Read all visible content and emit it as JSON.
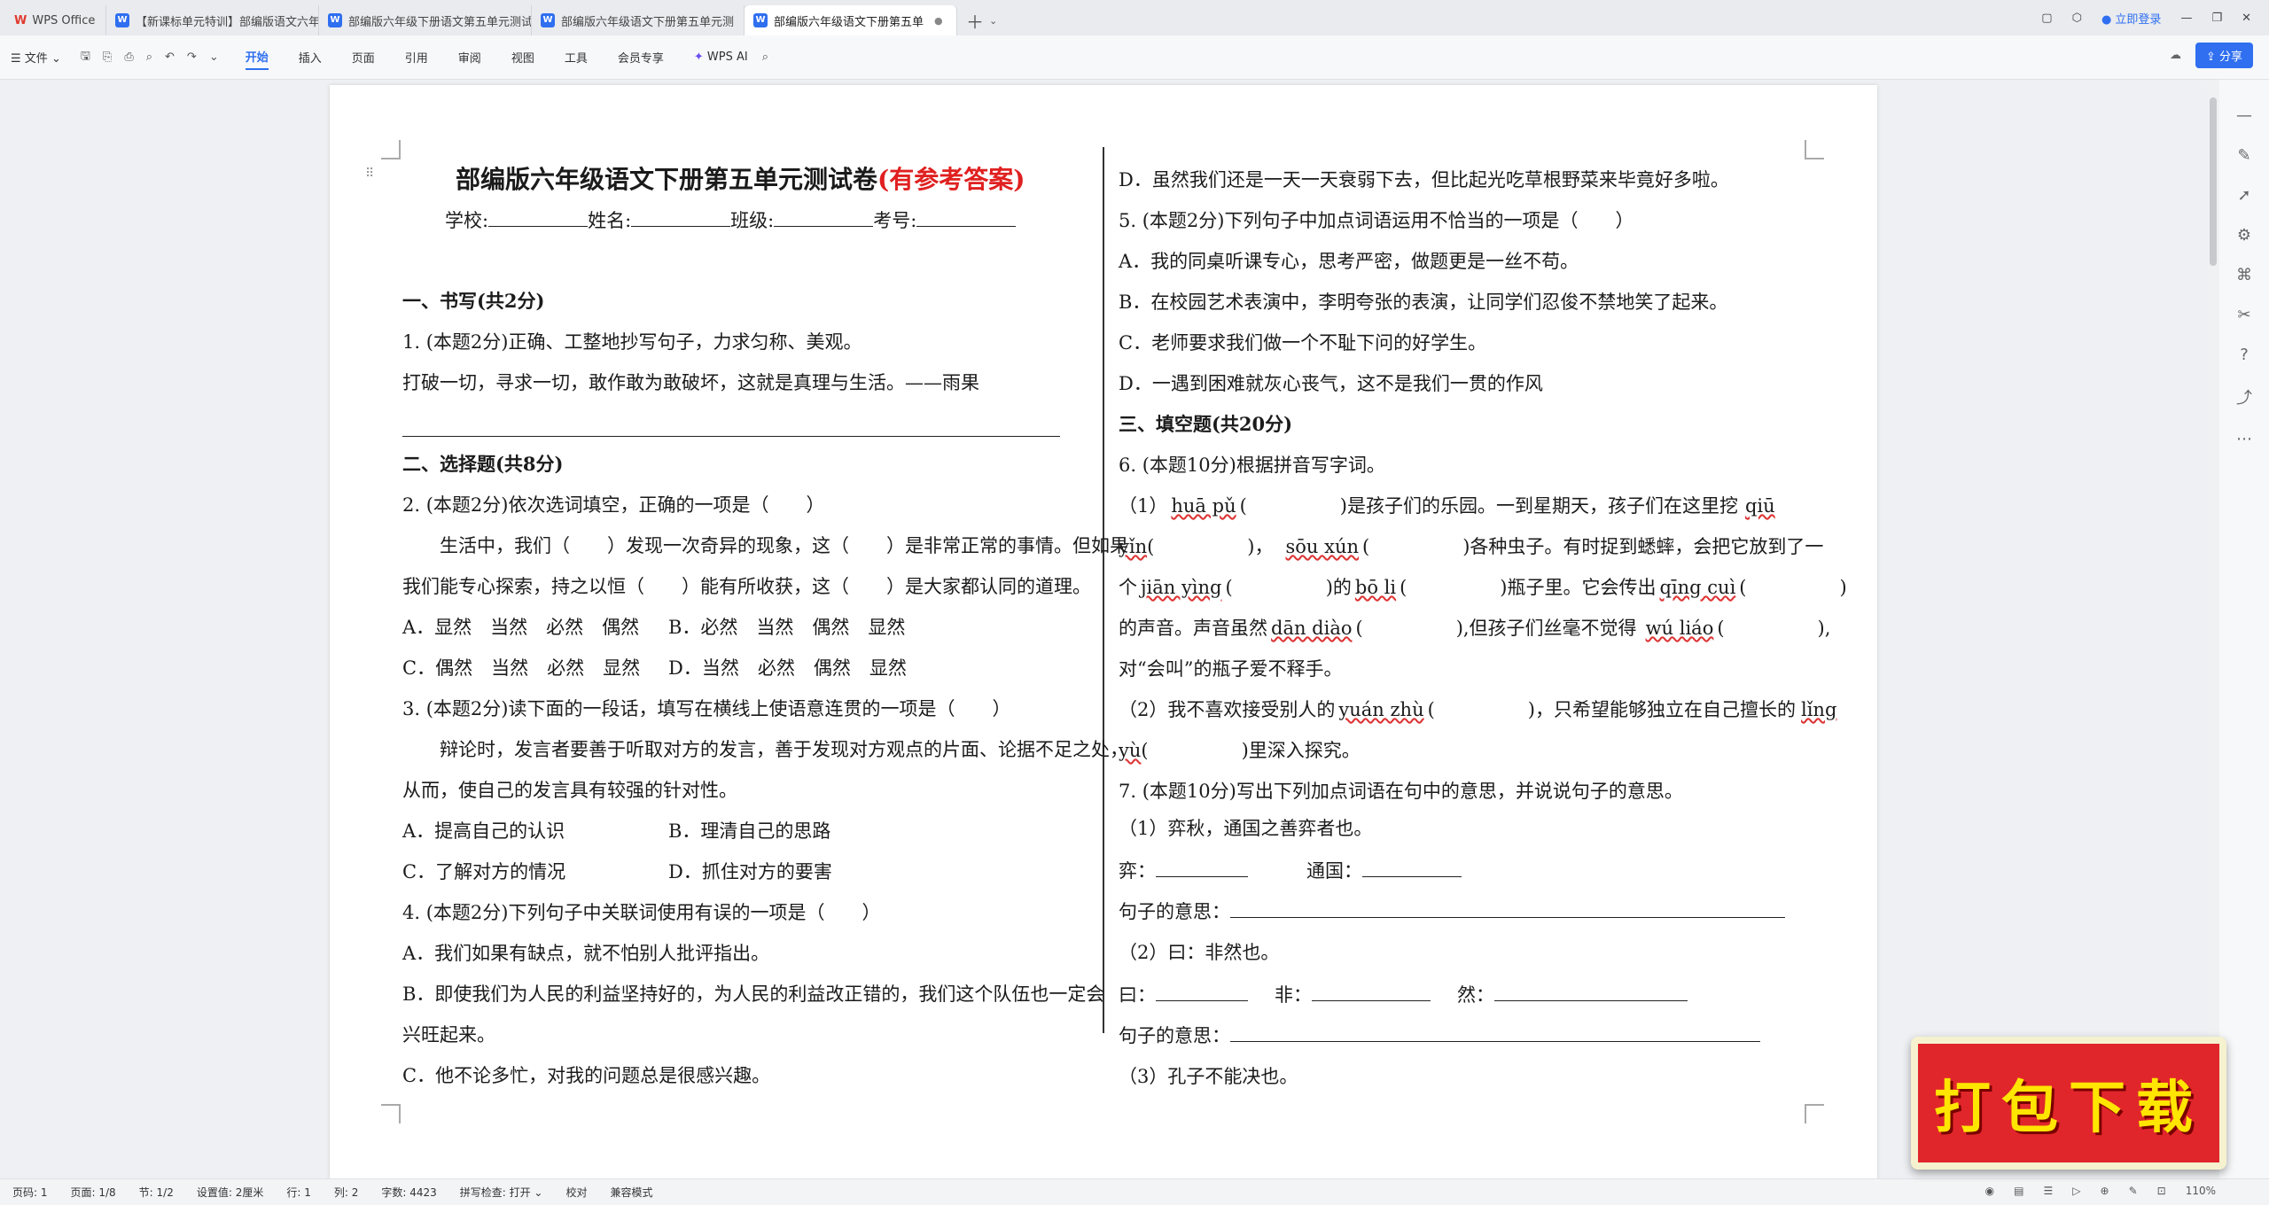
{
  "tabs": [
    {
      "label": "WPS Office",
      "icon": "wps-logo-icon"
    },
    {
      "label": "【新课标单元特训】部编版语文六年",
      "icon": "word-doc-icon"
    },
    {
      "label": "部编版六年级下册语文第五单元测试",
      "icon": "word-doc-icon"
    },
    {
      "label": "部编版六年级语文下册第五单元测",
      "icon": "word-doc-icon"
    },
    {
      "label": "部编版六年级语文下册第五单",
      "icon": "word-doc-icon"
    }
  ],
  "window": {
    "login_label": "立即登录",
    "share_label": "分享"
  },
  "ribbon": {
    "file_label": "文件",
    "menus": [
      "开始",
      "插入",
      "页面",
      "引用",
      "审阅",
      "视图",
      "工具",
      "会员专享"
    ],
    "ai_label": "WPS AI"
  },
  "document": {
    "title": "部编版六年级语文下册第五单元测试卷",
    "title_note": "(有参考答案)",
    "school_row": {
      "school": "学校:",
      "name": "姓名:",
      "class": "班级:",
      "exam_no": "考号:"
    },
    "left": {
      "s1": "一、书写(共2分)",
      "q1": "1. (本题2分)正确、工整地抄写句子，力求匀称、美观。",
      "q1_text": "打破一切，寻求一切，敢作敢为敢破坏，这就是真理与生活。——雨果",
      "s2": "二、选择题(共8分)",
      "q2": "2. (本题2分)依次选词填空，正确的一项是（　　）",
      "q2_p1": "生活中，我们（　　）发现一次奇异的现象，这（　　）是非常正常的事情。但如果",
      "q2_p2": "我们能专心探索，持之以恒（　　）能有所收获，这（　　）是大家都认同的道理。",
      "q2_a": "A．显然　当然　必然　偶然",
      "q2_b": "B．必然　当然　偶然　显然",
      "q2_c": "C．偶然　当然　必然　显然",
      "q2_d": "D．当然　必然　偶然　显然",
      "q3": "3. (本题2分)读下面的一段话，填写在横线上使语意连贯的一项是（　　）",
      "q3_p1": "辩论时，发言者要善于听取对方的发言，善于发现对方观点的片面、论据不足之处，",
      "q3_p2": "从而，使自己的发言具有较强的针对性。",
      "q3_a": "A．提高自己的认识",
      "q3_b": "B．理清自己的思路",
      "q3_c": "C．了解对方的情况",
      "q3_d": "D．抓住对方的要害",
      "q4": "4. (本题2分)下列句子中关联词使用有误的一项是（　　）",
      "q4_a": "A．我们如果有缺点，就不怕别人批评指出。",
      "q4_b1": "B．即使我们为人民的利益坚持好的，为人民的利益改正错的，我们这个队伍也一定会",
      "q4_b2": "兴旺起来。",
      "q4_c": "C．他不论多忙，对我的问题总是很感兴趣。"
    },
    "right": {
      "q4_d": "D．虽然我们还是一天一天衰弱下去，但比起光吃草根野菜来毕竟好多啦。",
      "q5": "5. (本题2分)下列句子中加点词语运用不恰当的一项是（　　）",
      "q5_a": "A．我的同桌听课专心，思考严密，做题更是一丝不苟。",
      "q5_b": "B．在校园艺术表演中，李明夸张的表演，让同学们忍俊不禁地笑了起来。",
      "q5_c": "C．老师要求我们做一个不耻下问的好学生。",
      "q5_d": "D．一遇到困难就灰心丧气，这不是我们一贯的作风",
      "s3": "三、填空题(共20分)",
      "q6": "6. (本题10分)根据拼音写字词。",
      "q6_l1": [
        "（1）",
        "huā pǔ",
        "(　　　　　)是孩子们的乐园。一到星期天，孩子们在这里挖",
        "qiū"
      ],
      "q6_l2": [
        "yǐn",
        "(　　　　　)，",
        "sōu xún",
        "(　　　　　)各种虫子。有时捉到蟋蟀，会把它放到了一"
      ],
      "q6_l3": [
        "个",
        "jiān yìng",
        "(　　　　　)的",
        "bō li",
        "(　　　　　)瓶子里。它会传出",
        "qīng cuì",
        "(　　　　　)"
      ],
      "q6_l4": [
        "的声音。声音虽然",
        "dān diào",
        "(　　　　　),但孩子们丝毫不觉得",
        "wú liáo",
        "(　　　　　),"
      ],
      "q6_l5": "对“会叫”的瓶子爱不释手。",
      "q6_l6": [
        "（2）我不喜欢接受别人的",
        "yuán zhù",
        "(　　　　　)，只希望能够独立在自己擅长的",
        "lǐng"
      ],
      "q6_l7": [
        "yù",
        "(　　　　　)里深入探究。"
      ],
      "q7": "7. (本题10分)写出下列加点词语在句中的意思，并说说句子的意思。",
      "q7_1": "（1）弈秋，通国之善弈者也。",
      "q7_1a": "弈：",
      "q7_1b": "通国：",
      "q7_mean": "句子的意思：",
      "q7_2": "（2）曰：非然也。",
      "q7_2a": "曰：",
      "q7_2b": "非：",
      "q7_2c": "然：",
      "q7_3": "（3）孔子不能决也。"
    }
  },
  "status": {
    "page_no": "页码: 1",
    "pages": "页面: 1/8",
    "section": "节: 1/2",
    "setting": "设置值: 2厘米",
    "row": "行: 1",
    "col": "列: 2",
    "words": "字数: 4423",
    "spell": "拼写检查: 打开",
    "proof": "校对",
    "compat": "兼容模式",
    "zoom": "110%"
  },
  "promo": {
    "label": "打包下载"
  },
  "colors": {
    "accent": "#2f6ff0",
    "title_red": "#e02020",
    "promo_red": "#e0262b",
    "promo_yellow": "#ffe500"
  }
}
